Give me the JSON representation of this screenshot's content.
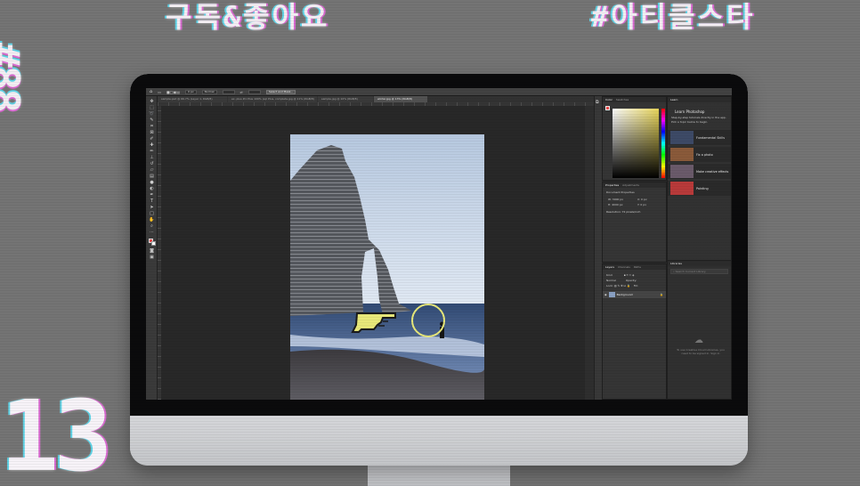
{
  "overlay": {
    "tag_left": "구독&좋아요",
    "tag_right": "#아티클스타",
    "side_text": "#88",
    "side_text_small": "8",
    "big_number": "13"
  },
  "photoshop": {
    "options_bar": {
      "feather": "0 px",
      "style": "Normal",
      "width": "",
      "height": "",
      "select_mask_button": "Select and Mask..."
    },
    "tabs": [
      {
        "label": "sample.psd @ 66.7% (Layer 1, RGB/8)",
        "active": false
      },
      {
        "label": "ex. plus #1 Plus 100% (sql Plus, complete.jpg @ 11% (RGB/8)",
        "active": false
      },
      {
        "label": "sample.jpg @ 10% (RGB/8)",
        "active": false
      },
      {
        "label": "winter.jpg @ 13% (RGB/8)",
        "active": true
      }
    ],
    "tools": [
      "move",
      "marquee",
      "lasso",
      "quick-select",
      "crop",
      "frame",
      "eyedropper",
      "healing",
      "brush",
      "stamp",
      "history-brush",
      "eraser",
      "gradient",
      "blur",
      "dodge",
      "pen",
      "type",
      "path-select",
      "rectangle",
      "hand",
      "zoom",
      "more",
      "foreground-color",
      "quick-mask",
      "screen-mode"
    ],
    "color_panel": {
      "tabs": [
        "Color",
        "Swatches"
      ]
    },
    "properties_panel": {
      "tabs": [
        "Properties",
        "Adjustments"
      ],
      "title": "Document Properties",
      "fields": [
        {
          "label": "W:",
          "value": "3000 px"
        },
        {
          "label": "H:",
          "value": "4000 px"
        },
        {
          "label": "X:",
          "value": "0 px"
        },
        {
          "label": "Y:",
          "value": "0 px"
        }
      ],
      "resolution": "Resolution: 72 pixels/inch"
    },
    "layers_panel": {
      "tabs": [
        "Layers",
        "Channels",
        "Paths"
      ],
      "kind": "Kind",
      "blend_mode": "Normal",
      "opacity": "Opacity:",
      "lock": "Lock:",
      "fill": "Fill:",
      "layers": [
        {
          "name": "Background",
          "visible": true
        }
      ]
    },
    "learn_panel": {
      "tab": "Learn",
      "title": "Learn Photoshop",
      "description": "Step-by-step tutorials directly in the app. Pick a topic below to begin.",
      "items": [
        {
          "label": "Fundamental Skills",
          "color": "#3d4a66"
        },
        {
          "label": "Fix a photo",
          "color": "#8a5a3a"
        },
        {
          "label": "Make creative effects",
          "color": "#6a5a6a"
        },
        {
          "label": "Painting",
          "color": "#b83a3a"
        }
      ]
    },
    "libraries_panel": {
      "tab": "Libraries",
      "search_placeholder": "Search Current Library",
      "empty_message": "To use Creative Cloud Libraries, you need to be signed in. Sign in"
    }
  },
  "colors": {
    "cursor_annotation": "#e8e87a",
    "background": "#747474",
    "ps_panel": "#353535"
  }
}
